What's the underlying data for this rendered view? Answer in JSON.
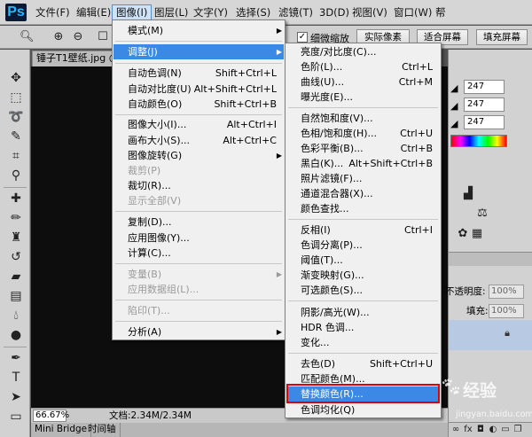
{
  "app": {
    "logo": "Ps"
  },
  "menubar": {
    "items": [
      "文件(F)",
      "编辑(E)",
      "图像(I)",
      "图层(L)",
      "文字(Y)",
      "选择(S)",
      "滤镜(T)",
      "3D(D)",
      "视图(V)",
      "窗口(W)",
      "帮"
    ]
  },
  "options": {
    "scrubby_zoom_label": "细微缩放",
    "actual_pixels": "实际像素",
    "fit_screen": "适合屏幕",
    "fill_screen": "填充屏幕"
  },
  "document": {
    "tab_title": "锤子T1壁纸.jpg @",
    "zoom": "66.67%",
    "doc_info": "文档:2.34M/2.34M"
  },
  "bottom_tabs": [
    "Mini Bridge",
    "时间轴"
  ],
  "color_panel": {
    "values": [
      "247",
      "247",
      "247"
    ]
  },
  "layers_panel": {
    "opacity_label": "不透明度:",
    "opacity_value": "100%",
    "fill_label": "填充:",
    "fill_value": "100%"
  },
  "image_menu": {
    "items": [
      {
        "label": "模式(M)",
        "shortcut": "",
        "submenu": true,
        "disabled": false
      },
      {
        "label": "调整(J)",
        "shortcut": "",
        "submenu": true,
        "disabled": false,
        "highlight": true
      },
      {
        "label": "自动色调(N)",
        "shortcut": "Shift+Ctrl+L"
      },
      {
        "label": "自动对比度(U)",
        "shortcut": "Alt+Shift+Ctrl+L"
      },
      {
        "label": "自动颜色(O)",
        "shortcut": "Shift+Ctrl+B"
      },
      {
        "label": "图像大小(I)...",
        "shortcut": "Alt+Ctrl+I"
      },
      {
        "label": "画布大小(S)...",
        "shortcut": "Alt+Ctrl+C"
      },
      {
        "label": "图像旋转(G)",
        "shortcut": "",
        "submenu": true
      },
      {
        "label": "裁剪(P)",
        "shortcut": "",
        "disabled": true
      },
      {
        "label": "裁切(R)...",
        "shortcut": ""
      },
      {
        "label": "显示全部(V)",
        "shortcut": "",
        "disabled": true
      },
      {
        "label": "复制(D)...",
        "shortcut": ""
      },
      {
        "label": "应用图像(Y)...",
        "shortcut": ""
      },
      {
        "label": "计算(C)...",
        "shortcut": ""
      },
      {
        "label": "变量(B)",
        "shortcut": "",
        "submenu": true,
        "disabled": true
      },
      {
        "label": "应用数据组(L)...",
        "shortcut": "",
        "disabled": true
      },
      {
        "label": "陷印(T)...",
        "shortcut": "",
        "disabled": true
      },
      {
        "label": "分析(A)",
        "shortcut": "",
        "submenu": true
      }
    ]
  },
  "adjust_menu": {
    "items": [
      {
        "label": "亮度/对比度(C)...",
        "shortcut": ""
      },
      {
        "label": "色阶(L)...",
        "shortcut": "Ctrl+L"
      },
      {
        "label": "曲线(U)...",
        "shortcut": "Ctrl+M"
      },
      {
        "label": "曝光度(E)...",
        "shortcut": ""
      },
      {
        "label": "自然饱和度(V)...",
        "shortcut": ""
      },
      {
        "label": "色相/饱和度(H)...",
        "shortcut": "Ctrl+U"
      },
      {
        "label": "色彩平衡(B)...",
        "shortcut": "Ctrl+B"
      },
      {
        "label": "黑白(K)...",
        "shortcut": "Alt+Shift+Ctrl+B"
      },
      {
        "label": "照片滤镜(F)...",
        "shortcut": ""
      },
      {
        "label": "通道混合器(X)...",
        "shortcut": ""
      },
      {
        "label": "颜色查找...",
        "shortcut": ""
      },
      {
        "label": "反相(I)",
        "shortcut": "Ctrl+I"
      },
      {
        "label": "色调分离(P)...",
        "shortcut": ""
      },
      {
        "label": "阈值(T)...",
        "shortcut": ""
      },
      {
        "label": "渐变映射(G)...",
        "shortcut": ""
      },
      {
        "label": "可选颜色(S)...",
        "shortcut": ""
      },
      {
        "label": "阴影/高光(W)...",
        "shortcut": ""
      },
      {
        "label": "HDR 色调...",
        "shortcut": ""
      },
      {
        "label": "变化...",
        "shortcut": ""
      },
      {
        "label": "去色(D)",
        "shortcut": "Shift+Ctrl+U"
      },
      {
        "label": "匹配颜色(M)...",
        "shortcut": ""
      },
      {
        "label": "替换颜色(R)...",
        "shortcut": "",
        "highlight": true
      },
      {
        "label": "色调均化(Q)",
        "shortcut": ""
      }
    ]
  },
  "watermark": {
    "text": "经验",
    "url": "jingyan.baidu.com"
  },
  "colors": {
    "highlight": "#3b89e4",
    "emphasis_box": "#e00000"
  }
}
